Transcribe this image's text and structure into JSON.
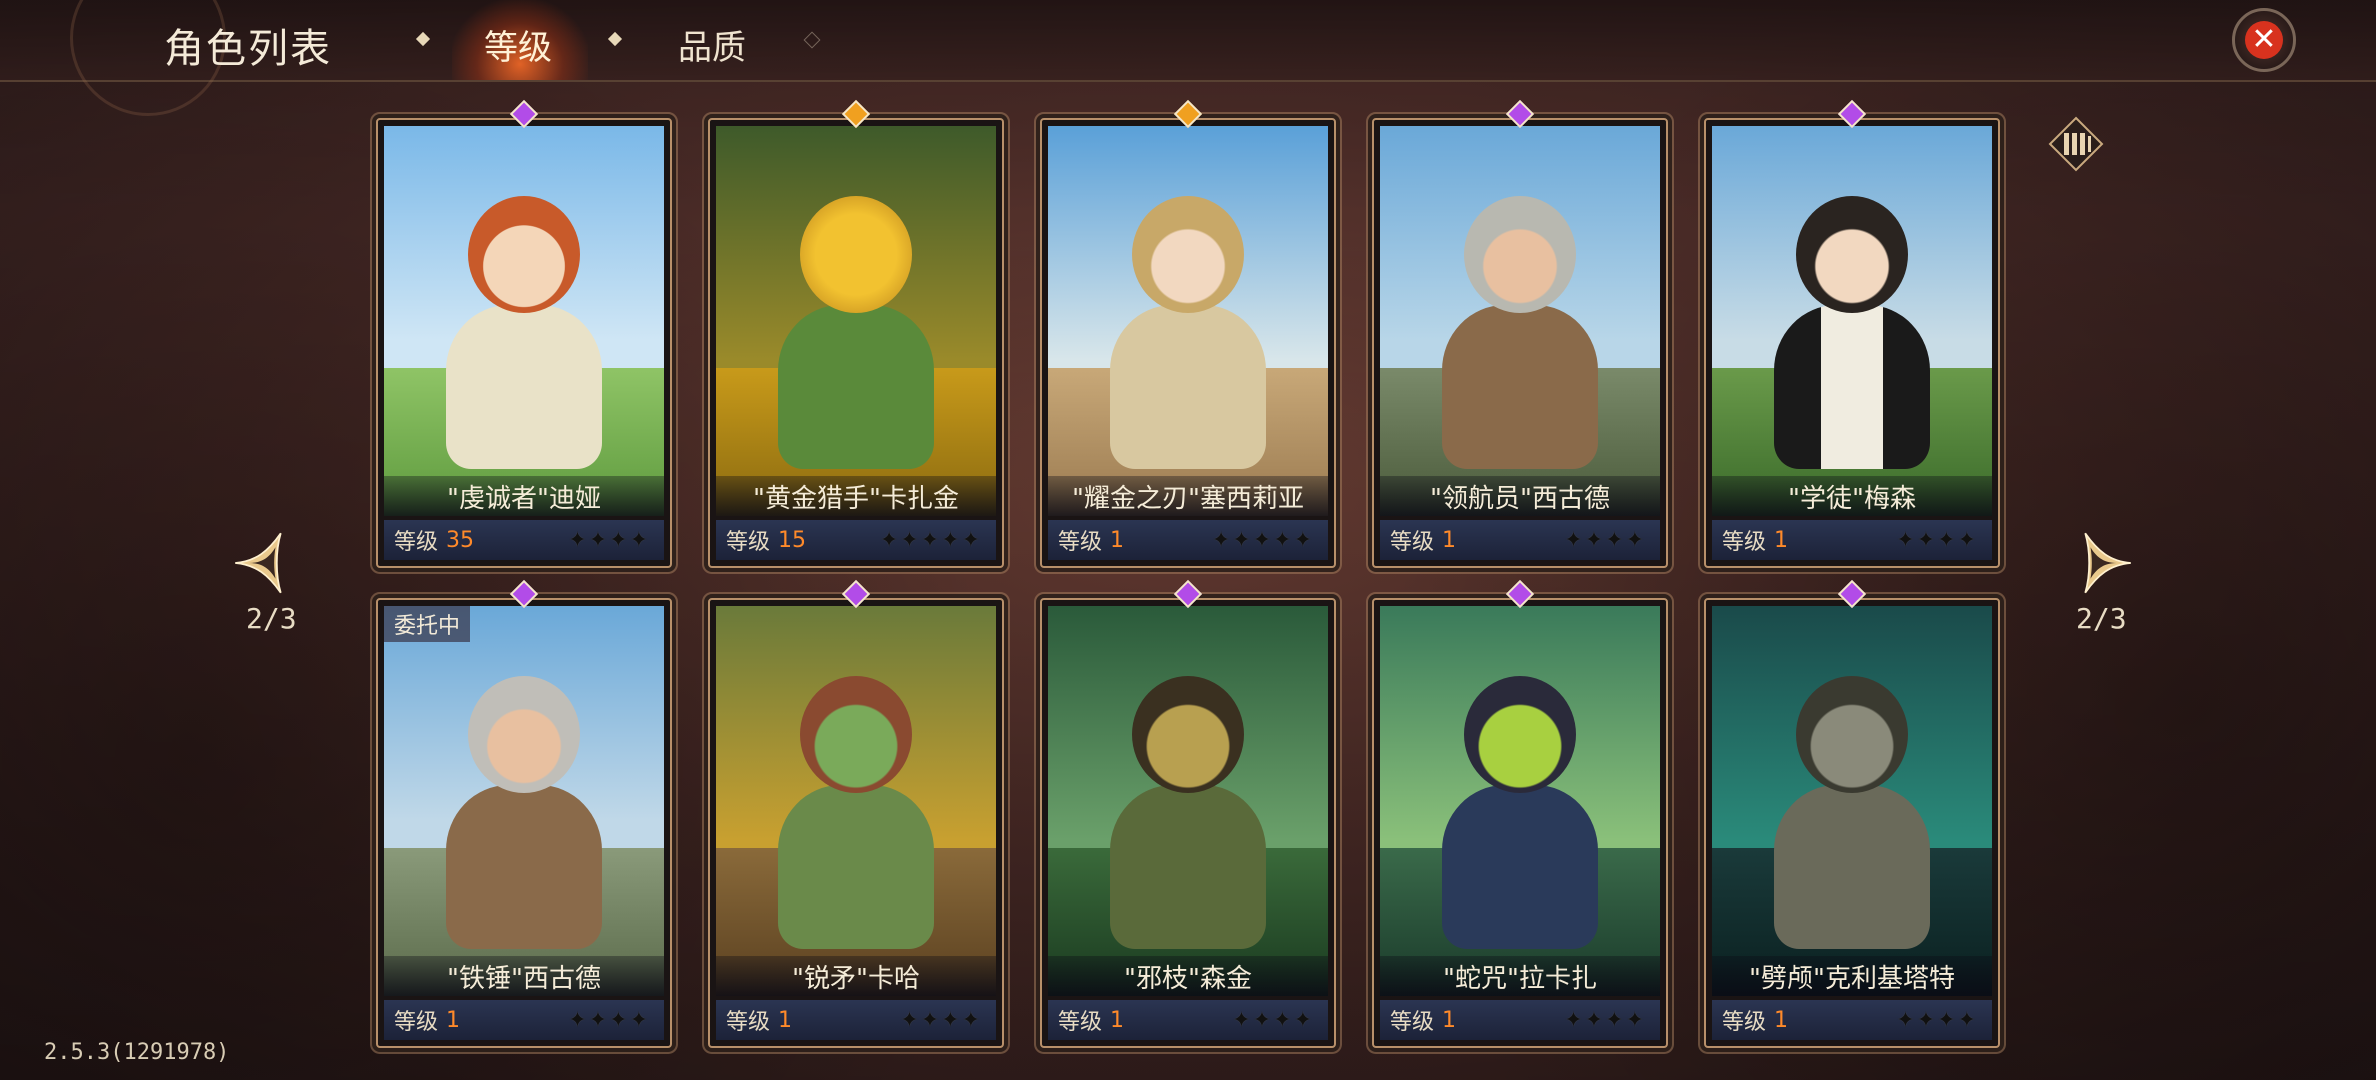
{
  "header": {
    "title": "角色列表",
    "tabs": [
      {
        "label": "等级",
        "active": true
      },
      {
        "label": "品质",
        "active": false
      }
    ],
    "close_icon": "close-icon"
  },
  "colors": {
    "accent_orange": "#ff8a2a",
    "gem_purple": "#b24ce8",
    "gem_gold": "#f0a020",
    "close_red": "#d8321e"
  },
  "cards": [
    {
      "name": "\"虔诚者\"迪娅",
      "level_label": "等级",
      "level": "35",
      "stars": "✦✦✦✦",
      "gem": "purple",
      "status": ""
    },
    {
      "name": "\"黄金猎手\"卡扎金",
      "level_label": "等级",
      "level": "15",
      "stars": "✦✦✦✦✦",
      "gem": "gold",
      "status": ""
    },
    {
      "name": "\"耀金之刃\"塞西莉亚",
      "level_label": "等级",
      "level": "1",
      "stars": "✦✦✦✦✦",
      "gem": "gold",
      "status": ""
    },
    {
      "name": "\"领航员\"西古德",
      "level_label": "等级",
      "level": "1",
      "stars": "✦✦✦✦",
      "gem": "purple",
      "status": ""
    },
    {
      "name": "\"学徒\"梅森",
      "level_label": "等级",
      "level": "1",
      "stars": "✦✦✦✦",
      "gem": "purple",
      "status": ""
    },
    {
      "name": "\"铁锤\"西古德",
      "level_label": "等级",
      "level": "1",
      "stars": "✦✦✦✦",
      "gem": "purple",
      "status": "委托中"
    },
    {
      "name": "\"锐矛\"卡哈",
      "level_label": "等级",
      "level": "1",
      "stars": "✦✦✦✦",
      "gem": "purple",
      "status": ""
    },
    {
      "name": "\"邪枝\"森金",
      "level_label": "等级",
      "level": "1",
      "stars": "✦✦✦✦",
      "gem": "purple",
      "status": ""
    },
    {
      "name": "\"蛇咒\"拉卡扎",
      "level_label": "等级",
      "level": "1",
      "stars": "✦✦✦✦",
      "gem": "purple",
      "status": ""
    },
    {
      "name": "\"劈颅\"克利基塔特",
      "level_label": "等级",
      "level": "1",
      "stars": "✦✦✦✦",
      "gem": "purple",
      "status": ""
    }
  ],
  "pagination": {
    "left": "2/3",
    "right": "2/3"
  },
  "version": "2.5.3(1291978)"
}
